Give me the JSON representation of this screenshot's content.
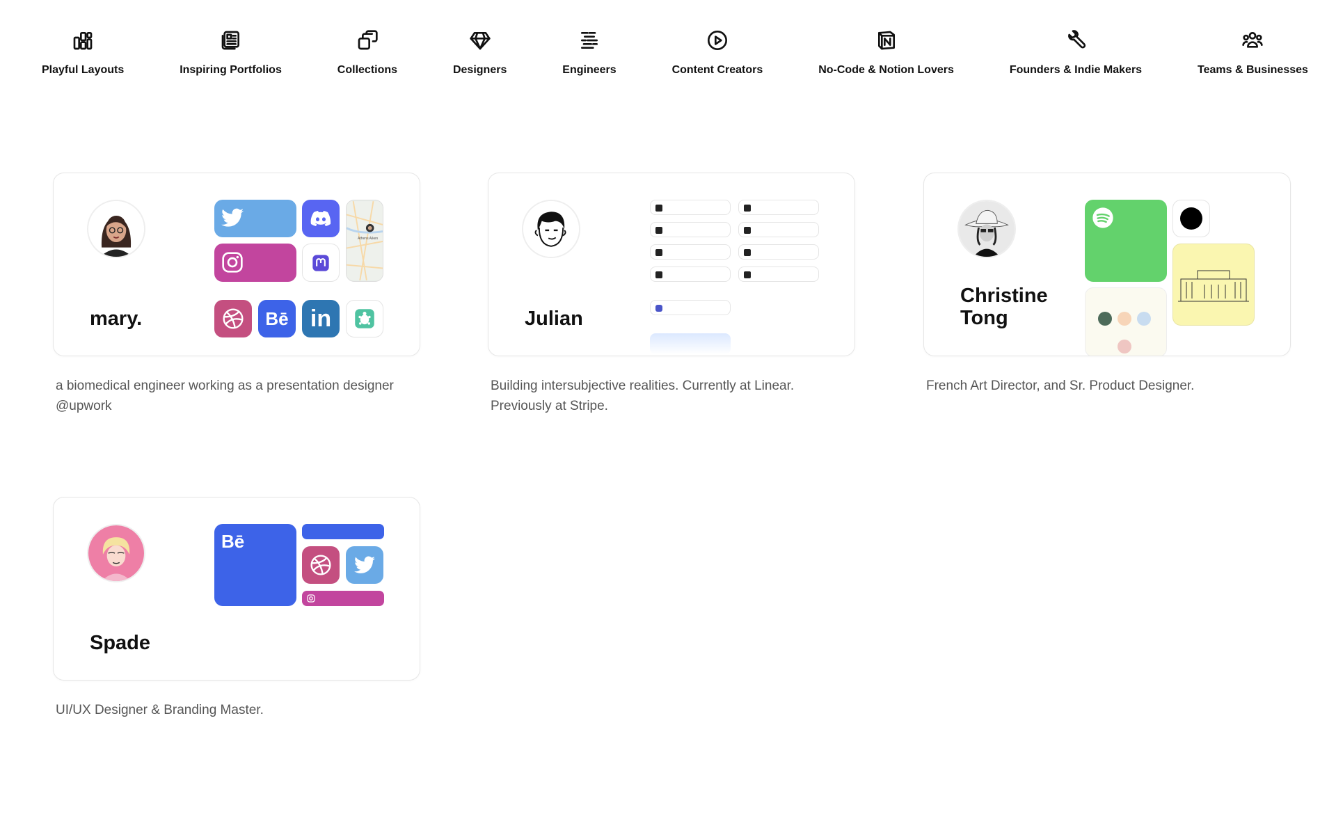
{
  "categories": [
    {
      "label": "Playful Layouts",
      "icon": "layout-blocks-icon"
    },
    {
      "label": "Inspiring Portfolios",
      "icon": "portfolio-icon"
    },
    {
      "label": "Collections",
      "icon": "collections-icon"
    },
    {
      "label": "Designers",
      "icon": "diamond-icon"
    },
    {
      "label": "Engineers",
      "icon": "code-lines-icon"
    },
    {
      "label": "Content Creators",
      "icon": "play-circle-icon"
    },
    {
      "label": "No-Code & Notion Lovers",
      "icon": "notion-icon"
    },
    {
      "label": "Founders & Indie Makers",
      "icon": "tools-icon"
    },
    {
      "label": "Teams & Businesses",
      "icon": "team-icon"
    }
  ],
  "profiles": [
    {
      "name": "mary.",
      "description": "a biomedical engineer working as a presentation designer @upwork"
    },
    {
      "name": "Julian",
      "description": "Building intersubjective realities. Currently at Linear. Previously at Stripe."
    },
    {
      "name": "Christine Tong",
      "name_line1": "Christine",
      "name_line2": "Tong",
      "description": "French Art Director, and Sr. Product Designer."
    },
    {
      "name": "Spade",
      "description": "UI/UX Designer & Branding Master."
    }
  ],
  "tiles": {
    "behance_label": "Bē",
    "linkedin_label": "in",
    "map_text": "Athens Aiken"
  },
  "colors": {
    "twitter": "#6aaae6",
    "discord": "#5865f2",
    "instagram": "#c2459e",
    "dribbble": "#c44f80",
    "behance": "#3d63e8",
    "linkedin": "#2e76b2",
    "spotify": "#63d26c",
    "cream": "#faf6b0"
  }
}
